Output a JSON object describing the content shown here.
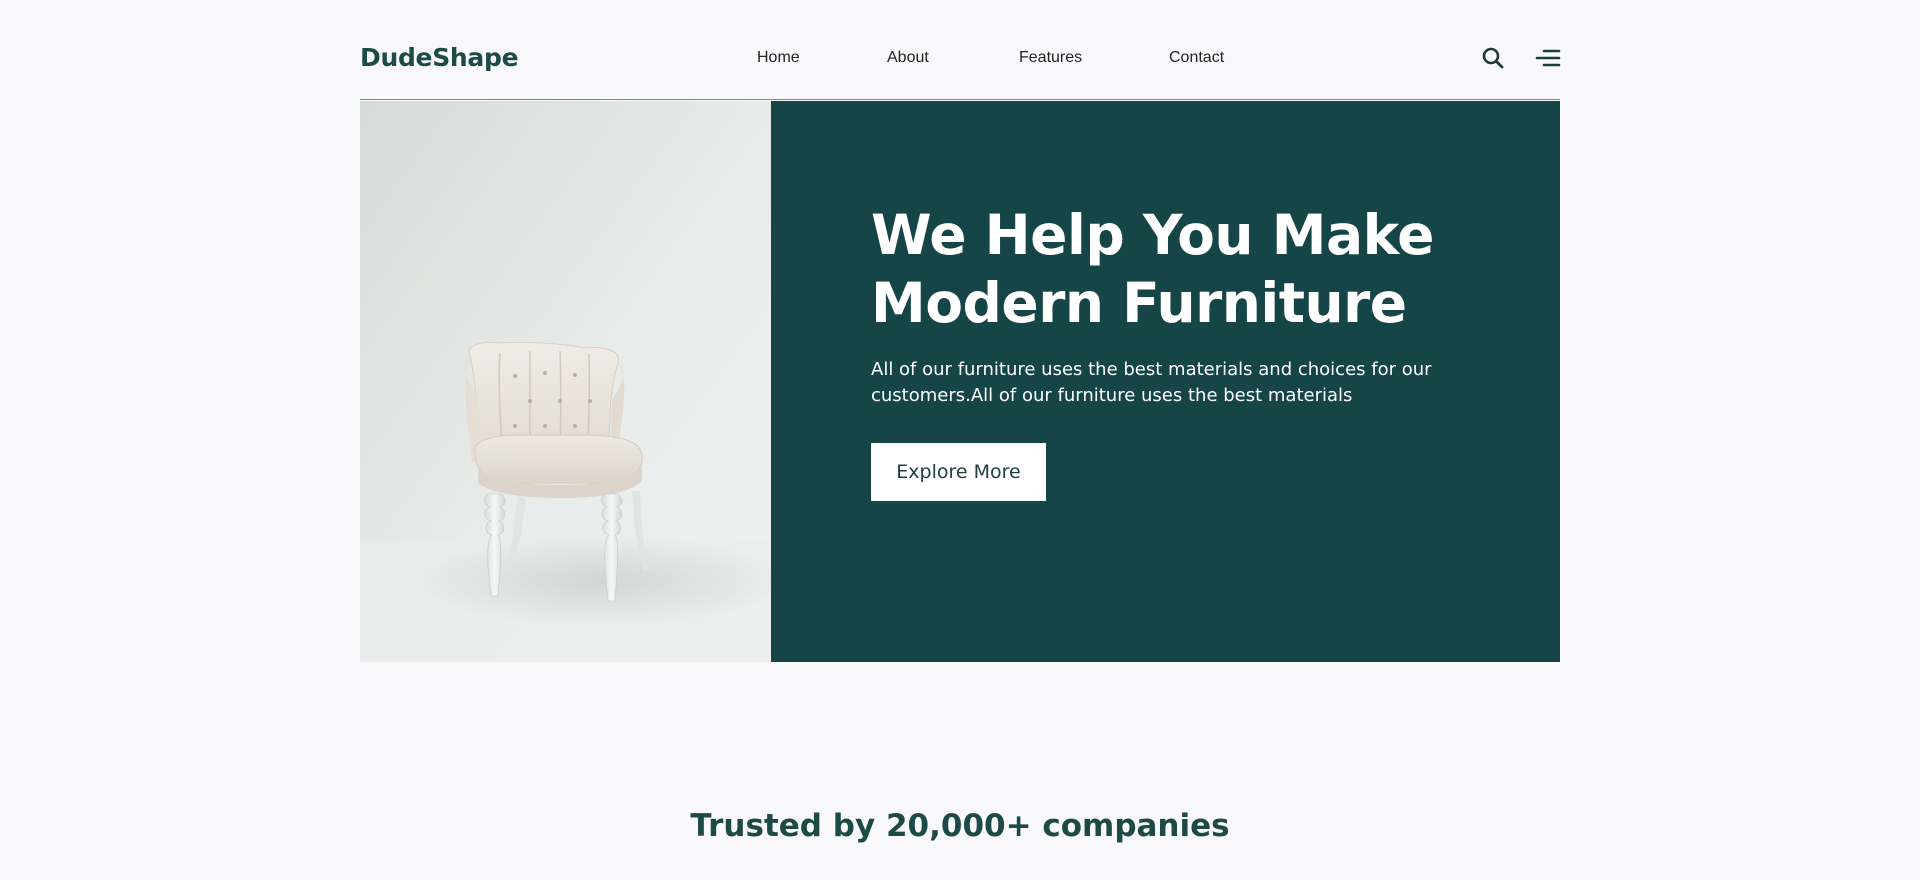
{
  "header": {
    "logo": "DudeShape",
    "nav": {
      "home": "Home",
      "about": "About",
      "features": "Features",
      "contact": "Contact"
    },
    "icons": {
      "search": "search-icon",
      "menu": "menu-icon"
    }
  },
  "hero": {
    "image": "white-tufted-armchair-photo",
    "title": "We Help You Make Modern Furniture",
    "description": "All of our furniture uses the best materials and choices for our customers.All of our furniture uses the best materials",
    "button_label": "Explore More"
  },
  "trusted": {
    "heading": "Trusted by 20,000+ companies"
  },
  "colors": {
    "brand": "#164547",
    "background": "#f9f9fc",
    "heading": "#1d4a47"
  }
}
